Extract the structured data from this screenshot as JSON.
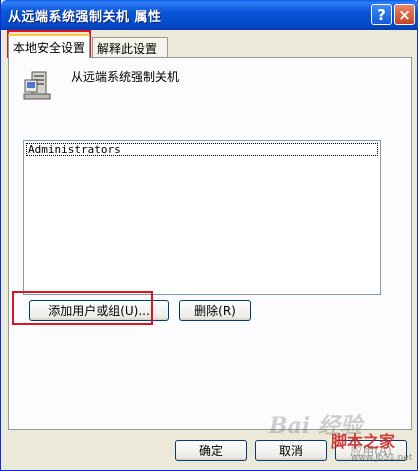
{
  "window": {
    "title": "从远端系统强制关机 属性",
    "help_label": "?",
    "close_label": "×"
  },
  "tabs": [
    {
      "label": "本地安全设置",
      "active": true
    },
    {
      "label": "解释此设置",
      "active": false
    }
  ],
  "policy": {
    "name": "从远端系统强制关机",
    "icon": "policy-computer-icon"
  },
  "list": {
    "items": [
      "Administrators"
    ]
  },
  "buttons": {
    "add_user_group": "添加用户或组(U)...",
    "remove": "删除(R)",
    "ok": "确定",
    "cancel": "取消",
    "apply": "应用(A)"
  },
  "watermarks": {
    "baidu": "Bai 经验",
    "jb51": "脚本之家",
    "url": "www.jb51.net"
  },
  "colors": {
    "titlebar": "#0b55d8",
    "highlight": "#e0141e",
    "tab_accent": "#ffc83c"
  }
}
